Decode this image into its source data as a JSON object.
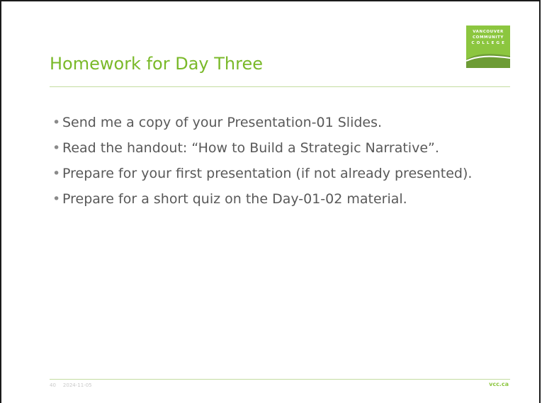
{
  "slide": {
    "title": "Homework for Day Three",
    "logo": {
      "line1": "VANCOUVER",
      "line2": "COMMUNITY",
      "line3": "C O L L E G E",
      "color": "#8cc63f"
    },
    "bullets": [
      "Send me a copy of your Presentation-01 Slides.",
      "Read the handout: “How to Build a Strategic Narrative”.",
      "Prepare for your first presentation (if not already presented).",
      "Prepare for a short quiz on the Day-01-02 material."
    ],
    "footer": {
      "page_number": "40",
      "date": "2024-11-05",
      "site": "vcc.ca"
    },
    "colors": {
      "accent": "#7ab929",
      "body_text": "#595959"
    }
  }
}
